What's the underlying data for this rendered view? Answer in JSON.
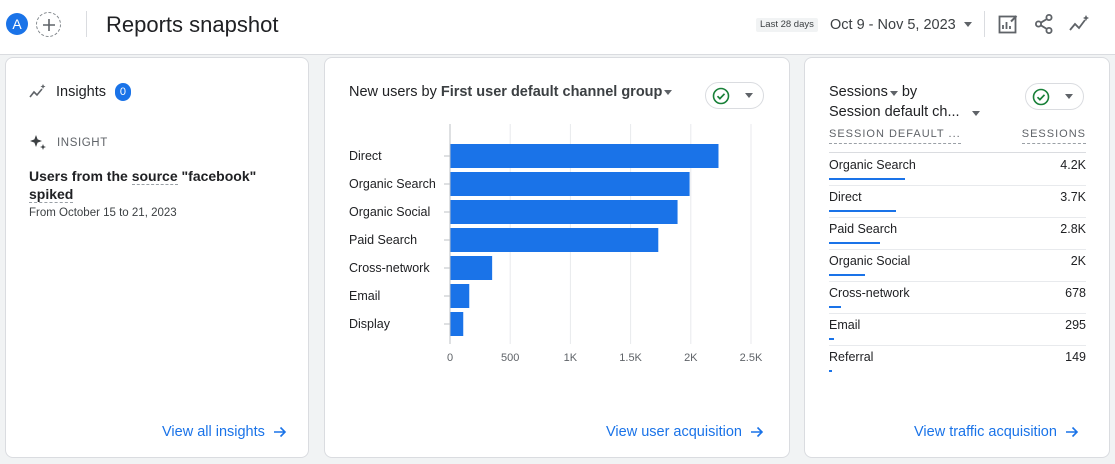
{
  "header": {
    "avatar_letter": "A",
    "title": "Reports snapshot",
    "date_chip": "Last 28 days",
    "date_range": "Oct 9 - Nov 5, 2023"
  },
  "insights_card": {
    "title": "Insights",
    "badge_count": "0",
    "kicker": "INSIGHT",
    "insight_title_pre": "Users from the ",
    "insight_title_source": "source",
    "insight_title_mid": " \"facebook\"",
    "insight_title_spiked": "spiked",
    "insight_subtitle": "From October 15 to 21, 2023",
    "link": "View all insights"
  },
  "acquisition_card": {
    "title_metric": "New users by",
    "title_dimension": "First user default channel group",
    "link": "View user acquisition"
  },
  "chart_data": {
    "type": "bar",
    "orientation": "horizontal",
    "categories": [
      "Direct",
      "Organic Search",
      "Organic Social",
      "Paid Search",
      "Cross-network",
      "Email",
      "Display"
    ],
    "values": [
      2230,
      1990,
      1890,
      1730,
      350,
      160,
      110
    ],
    "xticks": [
      "0",
      "500",
      "1K",
      "1.5K",
      "2K",
      "2.5K"
    ],
    "xtick_values": [
      0,
      500,
      1000,
      1500,
      2000,
      2500
    ],
    "xlim": [
      0,
      2500
    ],
    "grid": true,
    "bar_color": "#1a73e8"
  },
  "traffic_card": {
    "title_metric": "Sessions",
    "title_by": " by",
    "title_dimension": "Session default ch...",
    "col_left": "SESSION DEFAULT ...",
    "col_right": "SESSIONS",
    "rows": [
      {
        "label": "Organic Search",
        "value": "4.2K",
        "share": 1.0
      },
      {
        "label": "Direct",
        "value": "3.7K",
        "share": 0.88
      },
      {
        "label": "Paid Search",
        "value": "2.8K",
        "share": 0.67
      },
      {
        "label": "Organic Social",
        "value": "2K",
        "share": 0.48
      },
      {
        "label": "Cross-network",
        "value": "678",
        "share": 0.16
      },
      {
        "label": "Email",
        "value": "295",
        "share": 0.07
      },
      {
        "label": "Referral",
        "value": "149",
        "share": 0.04
      }
    ],
    "link": "View traffic acquisition"
  },
  "colors": {
    "accent": "#1a73e8",
    "check_green": "#188038"
  },
  "icons": [
    "plus-icon",
    "customize-report-icon",
    "share-icon",
    "insights-sparkline-icon",
    "sparkle-icon",
    "checkmark-icon",
    "arrow-right-icon",
    "chevron-down-icon"
  ]
}
